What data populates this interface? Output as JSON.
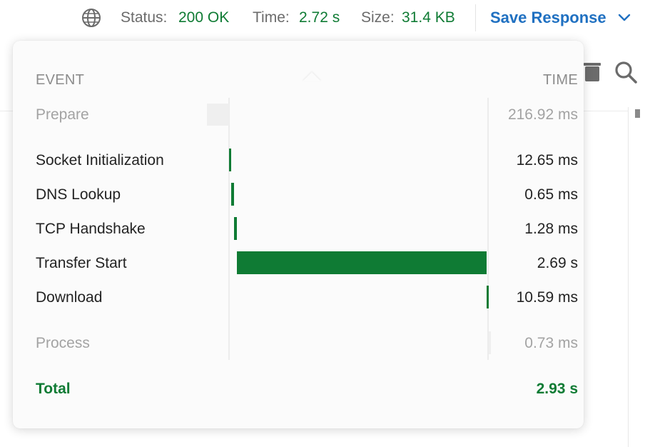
{
  "status_bar": {
    "status_label": "Status:",
    "status_value": "200 OK",
    "time_label": "Time:",
    "time_value": "2.72 s",
    "size_label": "Size:",
    "size_value": "31.4 KB",
    "save_label": "Save Response",
    "accent_color": "#0f7b34",
    "link_color": "#1f70c1"
  },
  "timeline": {
    "header_event": "EVENT",
    "header_time": "TIME",
    "rows": [
      {
        "label": "Prepare",
        "time": "216.92 ms",
        "muted": true
      },
      {
        "label": "Socket Initialization",
        "time": "12.65 ms",
        "muted": false
      },
      {
        "label": "DNS Lookup",
        "time": "0.65 ms",
        "muted": false
      },
      {
        "label": "TCP Handshake",
        "time": "1.28 ms",
        "muted": false
      },
      {
        "label": "Transfer Start",
        "time": "2.69 s",
        "muted": false
      },
      {
        "label": "Download",
        "time": "10.59 ms",
        "muted": false
      },
      {
        "label": "Process",
        "time": "0.73 ms",
        "muted": true
      }
    ],
    "total_label": "Total",
    "total_value": "2.93 s"
  },
  "icons": {
    "network": "globe-icon",
    "save_menu": "chevron-down-icon",
    "delete": "trash-icon",
    "search": "search-icon"
  }
}
